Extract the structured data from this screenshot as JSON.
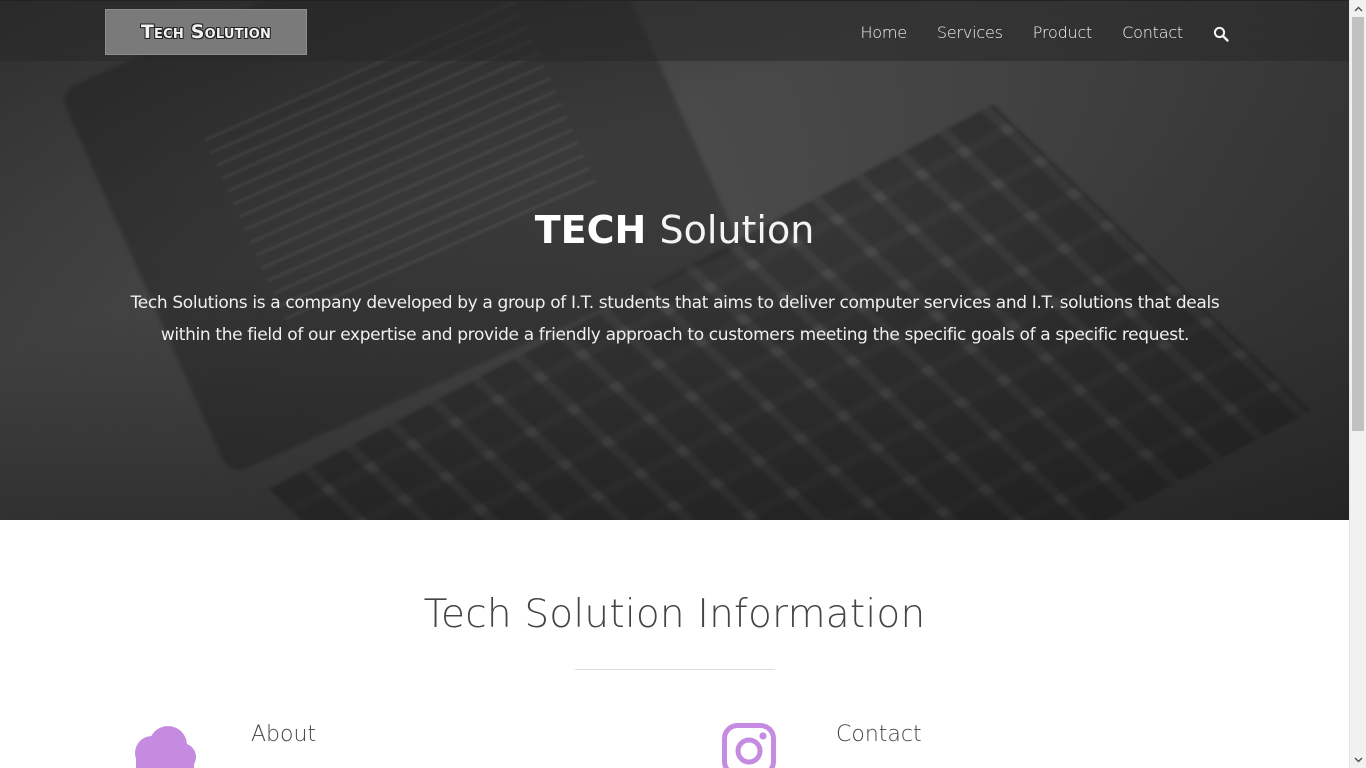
{
  "nav": {
    "logo_text": "Tech Solution",
    "links": [
      "Home",
      "Services",
      "Product",
      "Contact"
    ],
    "search_icon": "search-icon"
  },
  "hero": {
    "title_bold": "TECH",
    "title_light": "Solution",
    "description": "Tech Solutions is a company developed by a group of I.T. students that aims to deliver computer services and I.T. solutions that deals within the field of our expertise and provide a friendly approach to customers meeting the specific goals of a specific request."
  },
  "info": {
    "title": "Tech Solution Information",
    "features": [
      {
        "icon": "cloud-icon",
        "title": "About"
      },
      {
        "icon": "instagram-icon",
        "title": "Contact"
      }
    ],
    "icon_color": "#c58be0"
  },
  "colors": {
    "nav_bg": "#3a3a3a",
    "accent": "#c58be0",
    "text_dark": "#444444"
  }
}
